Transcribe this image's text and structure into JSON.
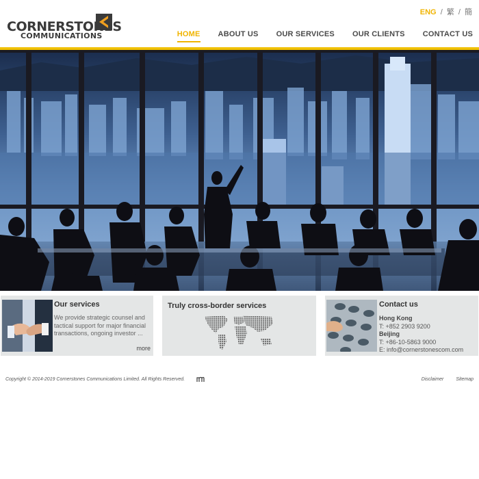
{
  "brand": {
    "name_line1": "CORNERSTONES",
    "name_line2": "COMMUNICATIONS",
    "accent_color": "#f0c000"
  },
  "language": {
    "active": "ENG",
    "options": [
      "繁",
      "簡"
    ],
    "separator": "/"
  },
  "nav": {
    "items": [
      {
        "label": "HOME",
        "active": true
      },
      {
        "label": "ABOUT US"
      },
      {
        "label": "OUR SERVICES"
      },
      {
        "label": "OUR CLIENTS"
      },
      {
        "label": "CONTACT US"
      }
    ]
  },
  "hero": {
    "image": "city-skyline-boardroom-silhouettes"
  },
  "cards": {
    "services": {
      "title": "Our services",
      "description": "We provide strategic counsel and tactical support for major financial transactions, ongoing investor ...",
      "more_label": "more",
      "image": "handshake-icon"
    },
    "crossborder": {
      "title": "Truly cross-border services",
      "image": "world-map-icon"
    },
    "contact": {
      "title": "Contact us",
      "image": "phone-keypad-icon",
      "hk_city": "Hong Kong",
      "hk_tel": "T: +852 2903 9200",
      "bj_city": "Beijing",
      "bj_tel": "T: +86-10-5863 9000",
      "email": "E: info@cornerstonescom.com"
    }
  },
  "footer": {
    "copyright": "Copyright © 2014-2019 Cornerstones Communications Limited. All Rights Reserved.",
    "links": [
      "Disclaimer",
      "Sitemap"
    ]
  }
}
